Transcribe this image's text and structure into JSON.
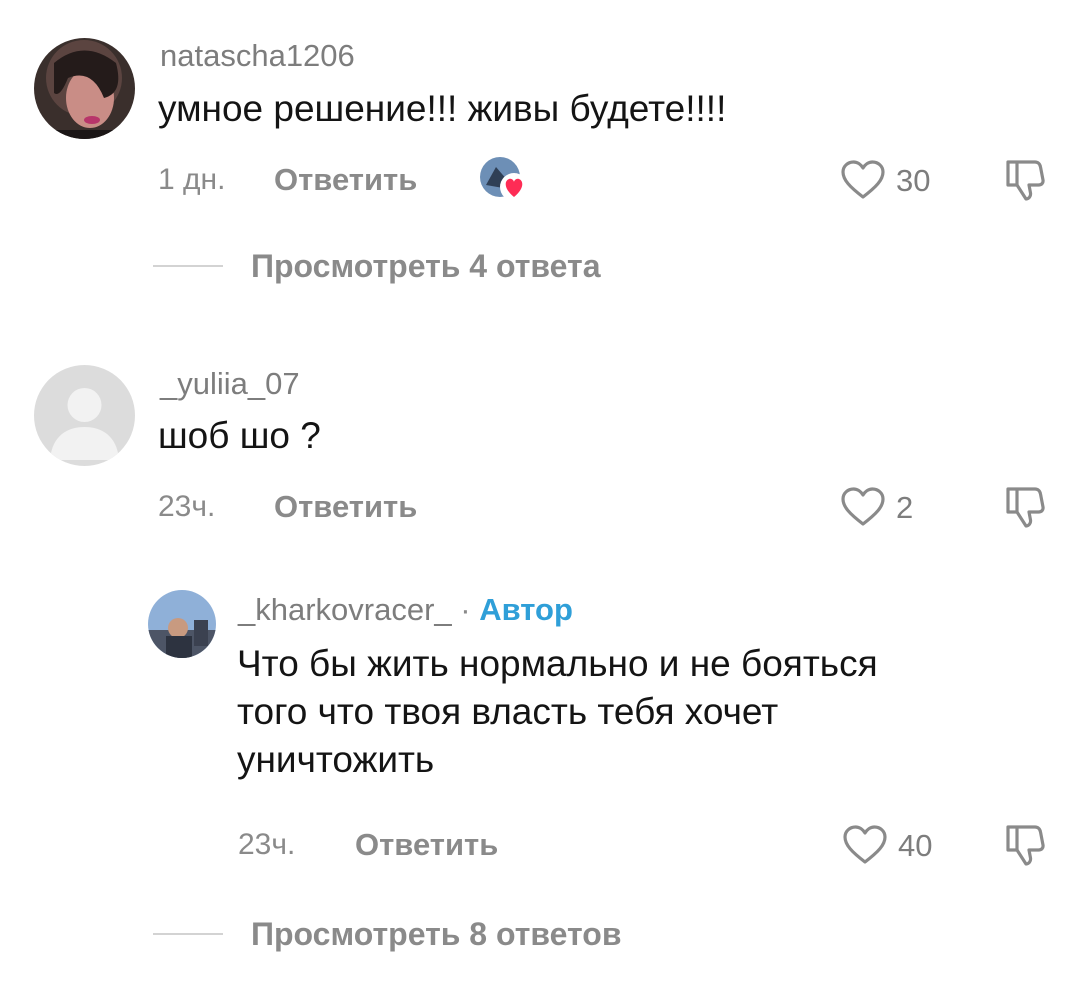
{
  "comments": [
    {
      "username": "natascha1206",
      "text": "умное решение!!! живы будете!!!!",
      "time": "1 дн.",
      "reply_label": "Ответить",
      "likes": "30",
      "view_replies": "Просмотреть 4 ответа",
      "liked_by_creator": true
    },
    {
      "username": "_yuliia_07",
      "text": "шоб шо ?",
      "time": "23ч.",
      "reply_label": "Ответить",
      "likes": "2"
    }
  ],
  "reply": {
    "username": "_kharkovracer_",
    "separator": "·",
    "author_badge": "Автор",
    "text_lines": [
      "Что бы жить нормально и не бояться",
      "того что твоя власть тебя хочет",
      "уничтожить"
    ],
    "time": "23ч.",
    "reply_label": "Ответить",
    "likes": "40",
    "view_replies": "Просмотреть 8 ответов"
  },
  "colors": {
    "author_badge": "#2f9fd8",
    "creator_heart": "#fe2c55",
    "muted_text": "#8a8a8a"
  },
  "icons": [
    "heart-outline-icon",
    "dislike-icon",
    "creator-liked-heart-icon",
    "default-avatar-icon"
  ]
}
